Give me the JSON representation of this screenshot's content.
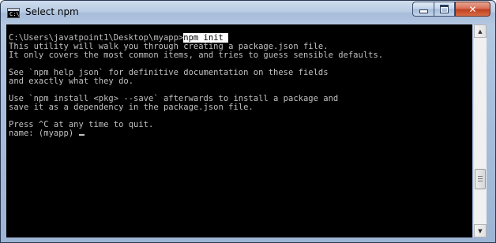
{
  "window": {
    "title": "Select npm",
    "icon": "cmd-console-icon",
    "icon_text": "C:\\",
    "buttons": {
      "minimize": "minimize-icon",
      "maximize": "maximize-icon",
      "close": "✕"
    }
  },
  "console": {
    "prompt": "C:\\Users\\javatpoint1\\Desktop\\myapp>",
    "command": "npm init ",
    "lines": [
      "This utility will walk you through creating a package.json file.",
      "It only covers the most common items, and tries to guess sensible defaults.",
      "",
      "See `npm help json` for definitive documentation on these fields",
      "and exactly what they do.",
      "",
      "Use `npm install <pkg> --save` afterwards to install a package and",
      "save it as a dependency in the package.json file.",
      "",
      "Press ^C at any time to quit."
    ],
    "input_prompt": "name: (myapp) ",
    "colors": {
      "background": "#000000",
      "foreground": "#c0c0c0"
    }
  },
  "scrollbar": {
    "up": "▲",
    "down": "▼"
  }
}
